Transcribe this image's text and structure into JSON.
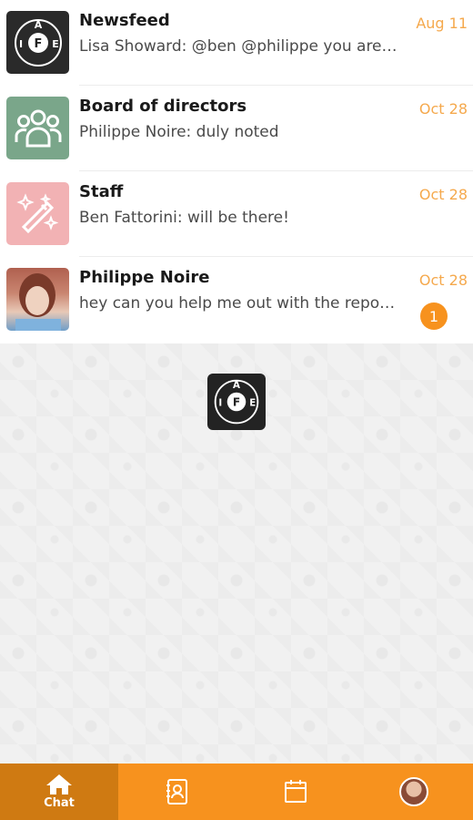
{
  "conversations": [
    {
      "title": "Newsfeed",
      "preview": "Lisa Showard: @ben @philippe you are …",
      "date": "Aug 11",
      "avatar_icon": "iatse-logo-icon"
    },
    {
      "title": "Board of directors",
      "preview": "Philippe Noire: duly noted",
      "date": "Oct 28",
      "avatar_icon": "group-icon"
    },
    {
      "title": "Staff",
      "preview": "Ben Fattorini: will be there!",
      "date": "Oct 28",
      "avatar_icon": "magic-wand-icon"
    },
    {
      "title": "Philippe Noire",
      "preview": "hey can you help me out with the repo…",
      "date": "Oct 28",
      "unread": "1",
      "avatar_icon": "user-photo"
    }
  ],
  "logo": {
    "letters": [
      "A",
      "I",
      "F",
      "E"
    ]
  },
  "tabbar": {
    "chat_label": "Chat",
    "tabs": [
      "home-icon",
      "contacts-icon",
      "calendar-icon",
      "profile-avatar"
    ],
    "accent": "#f7921e",
    "active": "#cf7a12"
  },
  "colors": {
    "date": "#f5a94d",
    "badge": "#f7921e"
  }
}
